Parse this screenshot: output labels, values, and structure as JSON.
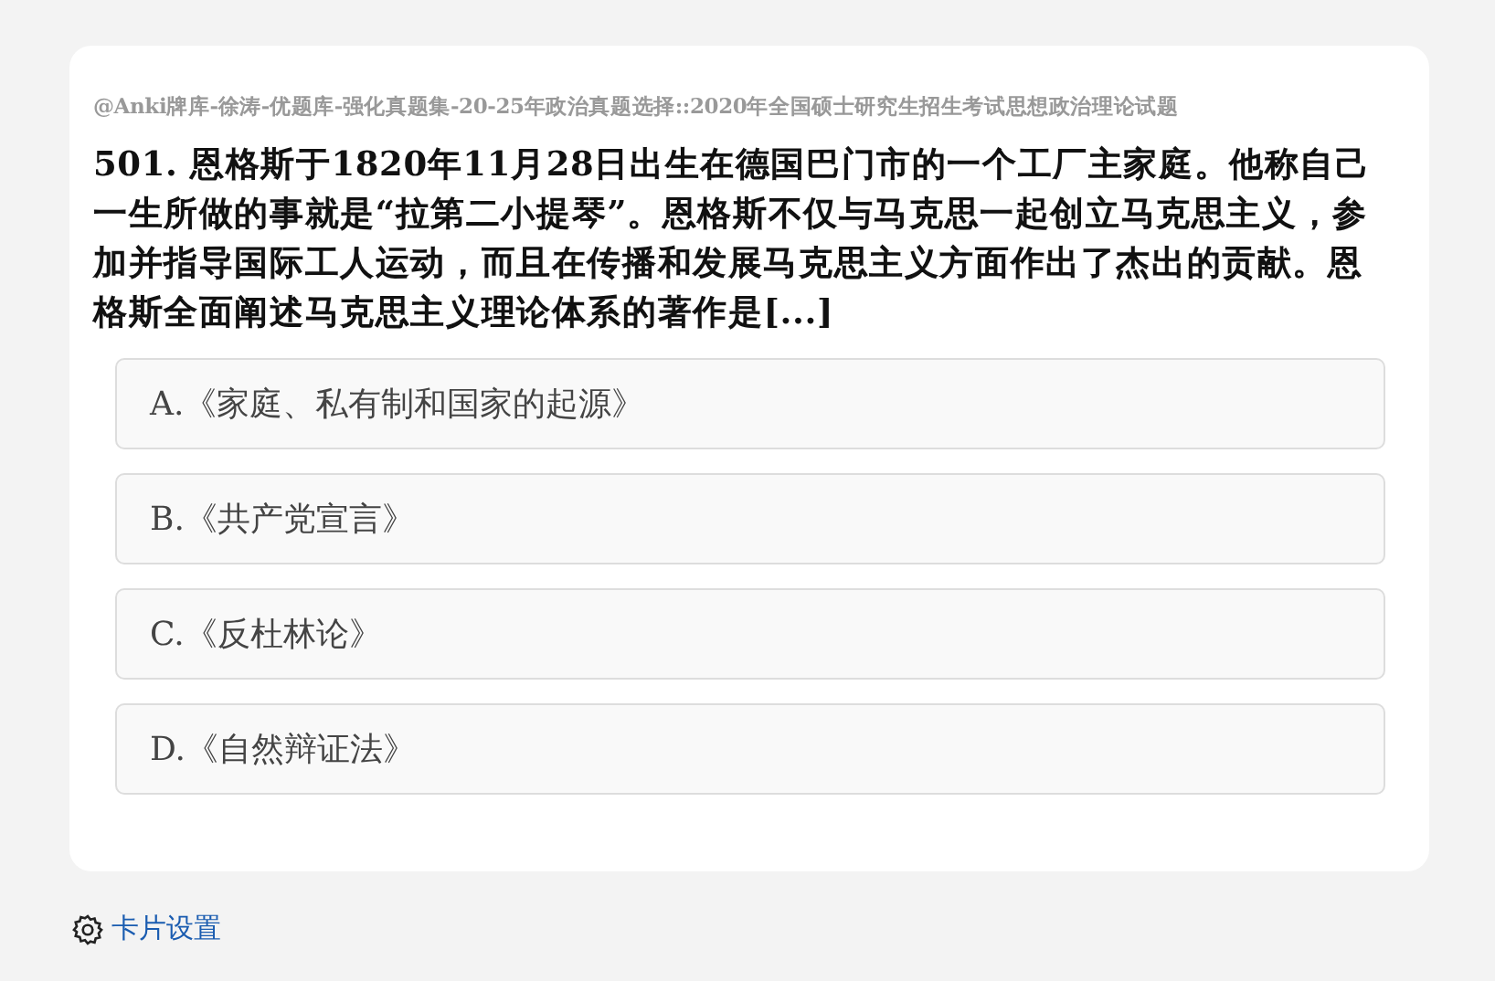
{
  "card": {
    "deck_path": "@Anki牌库-徐涛-优题库-强化真题集-20-25年政治真题选择::2020年全国硕士研究生招生考试思想政治理论试题",
    "question": "501. 恩格斯于1820年11月28日出生在德国巴门市的一个工厂主家庭。他称自己一生所做的事就是“拉第二小提琴”。恩格斯不仅与马克思一起创立马克思主义，参加并指导国际工人运动，而且在传播和发展马克思主义方面作出了杰出的贡献。恩格斯全面阐述马克思主义理论体系的著作是[...]",
    "options": [
      {
        "label": "A.《家庭、私有制和国家的起源》",
        "selected": false
      },
      {
        "label": "B.《共产党宣言》",
        "selected": false
      },
      {
        "label": "C.《反杜林论》",
        "selected": false
      },
      {
        "label": "D.《自然辩证法》",
        "selected": false
      }
    ]
  },
  "settings_link": "卡片设置"
}
